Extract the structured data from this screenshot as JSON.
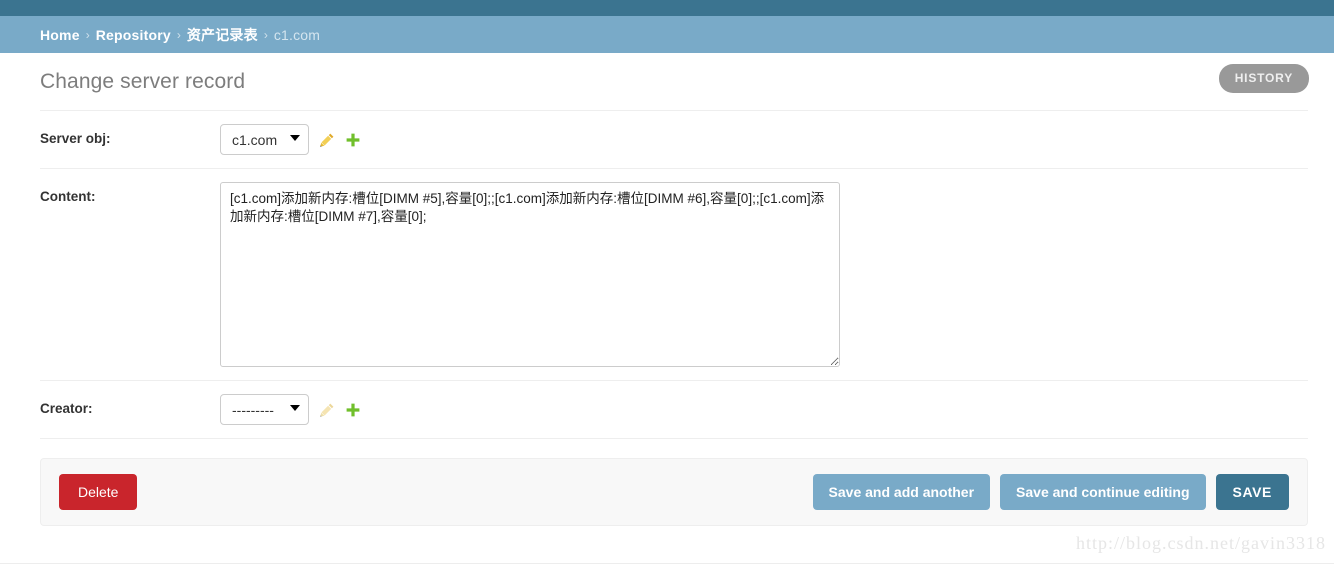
{
  "breadcrumbs": {
    "separator": "›",
    "items": [
      {
        "label": "Home",
        "current": false
      },
      {
        "label": "Repository",
        "current": false
      },
      {
        "label": "资产记录表",
        "current": false
      },
      {
        "label": "c1.com",
        "current": true
      }
    ]
  },
  "header": {
    "title": "Change server record",
    "history_label": "HISTORY"
  },
  "form": {
    "rows": [
      {
        "label": "Server obj:",
        "type": "select",
        "value": "c1.com",
        "options": [
          "c1.com"
        ],
        "edit_icon": "pencil-icon",
        "add_icon": "plus-icon"
      },
      {
        "label": "Content:",
        "type": "textarea",
        "value": "[c1.com]添加新内存:槽位[DIMM #5],容量[0];;[c1.com]添加新内存:槽位[DIMM #6],容量[0];;[c1.com]添加新内存:槽位[DIMM #7],容量[0];",
        "placeholder": ""
      },
      {
        "label": "Creator:",
        "type": "select",
        "value": "---------",
        "options": [
          "---------"
        ],
        "edit_icon": "pencil-icon",
        "add_icon": "plus-icon"
      }
    ]
  },
  "actions": {
    "delete_label": "Delete",
    "save_add_another_label": "Save and add another",
    "save_continue_label": "Save and continue editing",
    "save_label": "SAVE"
  },
  "watermark": "http://blog.csdn.net/gavin3318",
  "colors": {
    "topbar": "#3b7490",
    "breadcrumb_bar": "#79aac8",
    "delete": "#c9252c",
    "save_default": "#79aac8",
    "save_primary": "#3b7490",
    "history": "#999999",
    "plus_icon": "#70bf2b",
    "pencil_icon": "#e8bb32"
  }
}
